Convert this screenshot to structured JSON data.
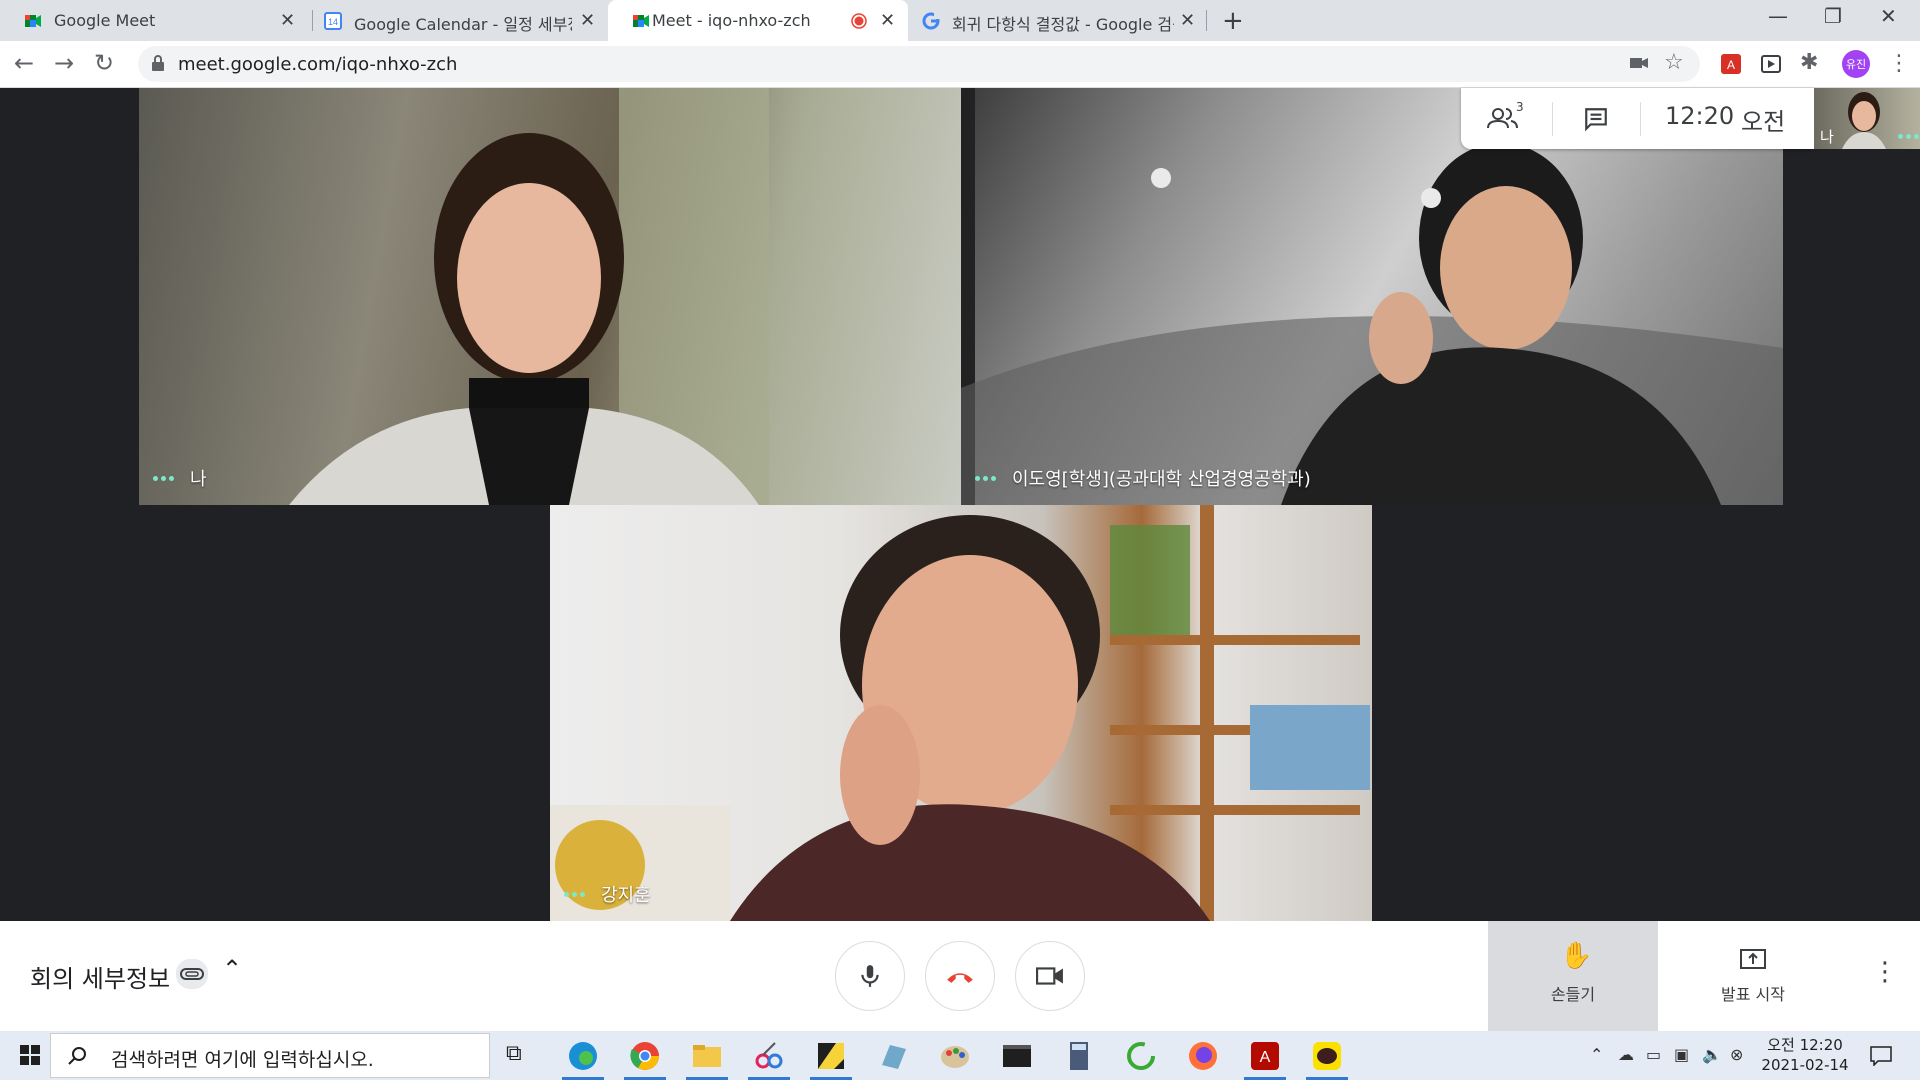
{
  "browser": {
    "tabs": [
      {
        "title": "Google Meet",
        "favicon": "google-meet-icon",
        "active": false
      },
      {
        "title": "Google Calendar - 일정 세부정보",
        "favicon": "google-calendar-icon",
        "active": false
      },
      {
        "title": "Meet - iqo-nhxo-zch",
        "favicon": "google-meet-icon",
        "active": true,
        "recording": true
      },
      {
        "title": "회귀 다항식 결정값 - Google 검색",
        "favicon": "google-g-icon",
        "active": false
      }
    ],
    "calendar_day": "14",
    "url": "meet.google.com/iqo-nhxo-zch",
    "profile_initials": "유진"
  },
  "meeting": {
    "participants_count": "3",
    "time": "12:20",
    "ampm": "오전",
    "self_label": "나",
    "tiles": [
      {
        "name": "나"
      },
      {
        "name": "이도영[학생](공과대학 산업경영공학과)"
      },
      {
        "name": "강지훈"
      }
    ]
  },
  "controls": {
    "details_label": "회의 세부정보",
    "raise_hand_label": "손들기",
    "present_label": "발표 시작"
  },
  "taskbar": {
    "search_placeholder": "검색하려면 여기에 입력하십시오.",
    "clock_ampm": "오전",
    "clock_time": "12:20",
    "clock_date": "2021-02-14"
  },
  "colors": {
    "accent_green": "#7de8c9",
    "end_call_red": "#ea4335",
    "stage_bg": "#202124"
  }
}
